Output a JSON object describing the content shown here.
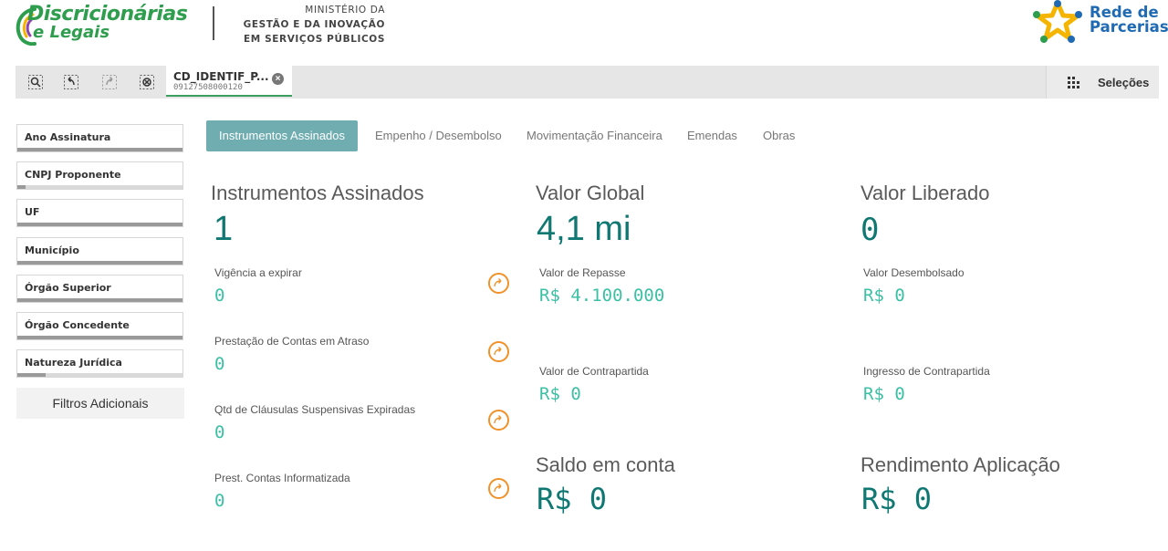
{
  "header": {
    "logo_line1": "Discricionárias",
    "logo_line2": "e Legais",
    "ministry_line1": "MINISTÉRIO DA",
    "ministry_line2": "GESTÃO E DA INOVAÇÃO",
    "ministry_line3": "EM SERVIÇOS PÚBLICOS",
    "partner_line1": "Rede de",
    "partner_line2": "Parcerias"
  },
  "toolbar": {
    "tools": [
      "smart-search-icon",
      "step-back-icon",
      "step-forward-icon",
      "clear-selections-icon"
    ],
    "selection": {
      "field": "CD_IDENTIF_P...",
      "value": "09127508000120"
    },
    "selections_label": "Seleções"
  },
  "sidebar": {
    "filters": [
      {
        "label": "Ano Assinatura",
        "fill": 1.0
      },
      {
        "label": "CNPJ Proponente",
        "fill": 0.05
      },
      {
        "label": "UF",
        "fill": 1.0
      },
      {
        "label": "Município",
        "fill": 1.0
      },
      {
        "label": "Órgão Superior",
        "fill": 1.0
      },
      {
        "label": "Órgão Concedente",
        "fill": 1.0
      },
      {
        "label": "Natureza Jurídica",
        "fill": 0.17
      }
    ],
    "extra_filters_label": "Filtros Adicionais"
  },
  "tabs": [
    {
      "label": "Instrumentos Assinados",
      "active": true
    },
    {
      "label": "Empenho / Desembolso",
      "active": false
    },
    {
      "label": "Movimentação Financeira",
      "active": false
    },
    {
      "label": "Emendas",
      "active": false
    },
    {
      "label": "Obras",
      "active": false
    }
  ],
  "kpis": {
    "instrumentos": {
      "title": "Instrumentos Assinados",
      "value": "1"
    },
    "valor_global": {
      "title": "Valor Global",
      "value": "4,1 mi"
    },
    "valor_liberado": {
      "title": "Valor Liberado",
      "value": "0"
    },
    "saldo": {
      "title": "Saldo em conta",
      "value": "R$ 0"
    },
    "rendimento": {
      "title": "Rendimento Aplicação",
      "value": "R$ 0"
    }
  },
  "details_left": [
    {
      "label": "Vigência a expirar",
      "value": "0"
    },
    {
      "label": "Prestação de Contas em Atraso",
      "value": "0"
    },
    {
      "label": "Qtd de Cláusulas Suspensivas Expiradas",
      "value": "0"
    },
    {
      "label": "Prest. Contas Informatizada",
      "value": "0"
    }
  ],
  "details_mid": [
    {
      "label": "Valor de Repasse",
      "value": "R$ 4.100.000"
    },
    {
      "label": "Valor de Contrapartida",
      "value": "R$ 0"
    }
  ],
  "details_right": [
    {
      "label": "Valor Desembolsado",
      "value": "R$ 0"
    },
    {
      "label": "Ingresso de Contrapartida",
      "value": "R$ 0"
    }
  ],
  "colors": {
    "accent_tab": "#6fadb1",
    "kpi_value": "#0f7873",
    "sub_value": "#3bc0a4",
    "arrow_icon": "#f0922a",
    "brand_green": "#2e9e4e",
    "brand_blue": "#1f6ab2"
  }
}
